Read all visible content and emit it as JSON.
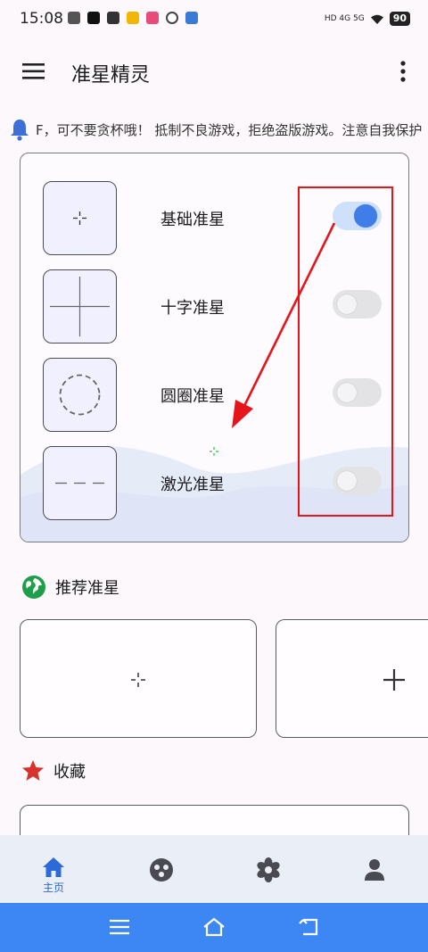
{
  "status_bar": {
    "time": "15:08",
    "network": "HD 4G 5G",
    "battery": "90"
  },
  "app_bar": {
    "title": "准星精灵"
  },
  "notice": {
    "text": "F，可不要贪杯哦！ 抵制不良游戏，拒绝盗版游戏。注意自我保护"
  },
  "crosshairs": [
    {
      "label": "基础准星",
      "enabled": true
    },
    {
      "label": "十字准星",
      "enabled": false
    },
    {
      "label": "圆圈准星",
      "enabled": false
    },
    {
      "label": "激光准星",
      "enabled": false
    }
  ],
  "recommend": {
    "title": "推荐准星"
  },
  "favorites": {
    "title": "收藏"
  },
  "bottom_nav": {
    "home_label": "主页"
  },
  "colors": {
    "accent": "#3f7ee8",
    "annotation_red": "#e5151a",
    "system_nav": "#3d87f5"
  }
}
